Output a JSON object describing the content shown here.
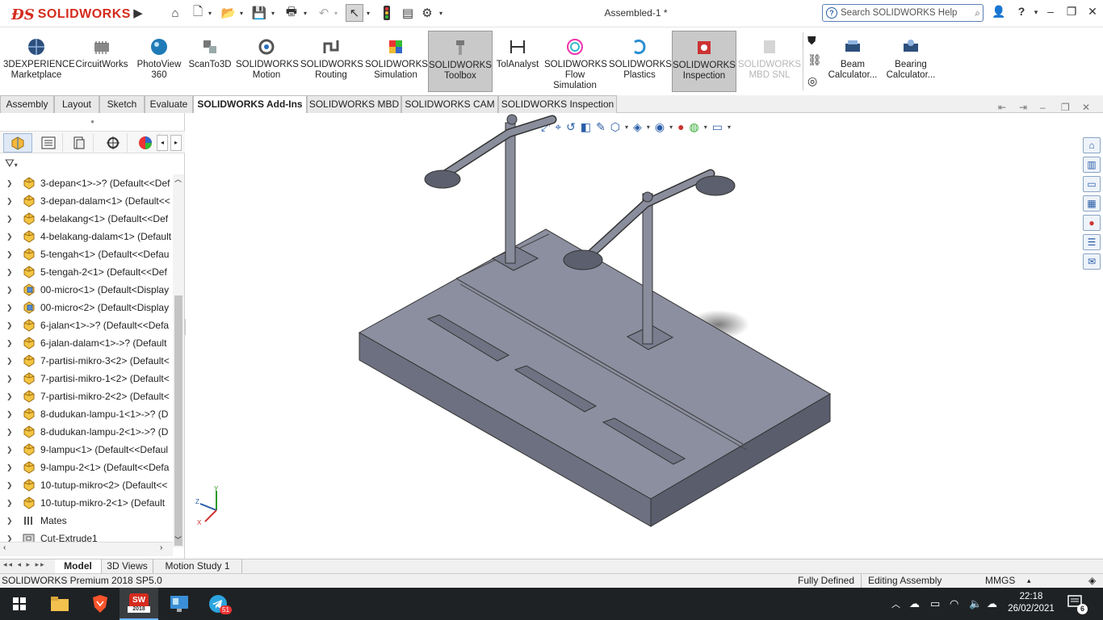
{
  "app": {
    "brand": "SOLIDWORKS",
    "document_title": "Assembled-1 *"
  },
  "search": {
    "placeholder": "Search SOLIDWORKS Help"
  },
  "commands": [
    {
      "label": "3DEXPERIENCE Marketplace",
      "icon": "globe-icon"
    },
    {
      "label": "CircuitWorks",
      "icon": "circuit-icon"
    },
    {
      "label": "PhotoView 360",
      "icon": "photoview-icon"
    },
    {
      "label": "ScanTo3D",
      "icon": "scan-icon"
    },
    {
      "label": "SOLIDWORKS Motion",
      "icon": "motion-icon"
    },
    {
      "label": "SOLIDWORKS Routing",
      "icon": "routing-icon"
    },
    {
      "label": "SOLIDWORKS Simulation",
      "icon": "simulation-icon"
    },
    {
      "label": "SOLIDWORKS Toolbox",
      "icon": "toolbox-icon",
      "state": "pressed"
    },
    {
      "label": "TolAnalyst",
      "icon": "tolanalyst-icon"
    },
    {
      "label": "SOLIDWORKS Flow Simulation",
      "icon": "flow-icon"
    },
    {
      "label": "SOLIDWORKS Plastics",
      "icon": "plastics-icon"
    },
    {
      "label": "SOLIDWORKS Inspection",
      "icon": "inspection-icon",
      "state": "pressed"
    },
    {
      "label": "SOLIDWORKS MBD SNL",
      "icon": "mbd-snl-icon",
      "state": "disabled"
    },
    {
      "label": "Beam Calculator...",
      "icon": "beam-calculator-icon"
    },
    {
      "label": "Bearing Calculator...",
      "icon": "bearing-calculator-icon"
    }
  ],
  "tabs": [
    "Assembly",
    "Layout",
    "Sketch",
    "Evaluate",
    "SOLIDWORKS Add-Ins",
    "SOLIDWORKS MBD",
    "SOLIDWORKS CAM",
    "SOLIDWORKS Inspection"
  ],
  "active_tab": "SOLIDWORKS Add-Ins",
  "tree": [
    {
      "label": "3-depan<1>->? (Default<<Def",
      "kind": "part"
    },
    {
      "label": "3-depan-dalam<1> (Default<<",
      "kind": "part"
    },
    {
      "label": "4-belakang<1> (Default<<Def",
      "kind": "part"
    },
    {
      "label": "4-belakang-dalam<1> (Default",
      "kind": "part"
    },
    {
      "label": "5-tengah<1> (Default<<Defau",
      "kind": "part"
    },
    {
      "label": "5-tengah-2<1> (Default<<Def",
      "kind": "part"
    },
    {
      "label": "00-micro<1> (Default<Display",
      "kind": "subassembly"
    },
    {
      "label": "00-micro<2> (Default<Display",
      "kind": "subassembly"
    },
    {
      "label": "6-jalan<1>->? (Default<<Defa",
      "kind": "part"
    },
    {
      "label": "6-jalan-dalam<1>->? (Default",
      "kind": "part"
    },
    {
      "label": "7-partisi-mikro-3<2> (Default<",
      "kind": "part"
    },
    {
      "label": "7-partisi-mikro-1<2> (Default<",
      "kind": "part"
    },
    {
      "label": "7-partisi-mikro-2<2> (Default<",
      "kind": "part"
    },
    {
      "label": "8-dudukan-lampu-1<1>->? (D",
      "kind": "part"
    },
    {
      "label": "8-dudukan-lampu-2<1>->? (D",
      "kind": "part"
    },
    {
      "label": "9-lampu<1> (Default<<Defaul",
      "kind": "part"
    },
    {
      "label": "9-lampu-2<1> (Default<<Defa",
      "kind": "part"
    },
    {
      "label": "10-tutup-mikro<2> (Default<<",
      "kind": "part"
    },
    {
      "label": "10-tutup-mikro-2<1> (Default",
      "kind": "part"
    },
    {
      "label": "Mates",
      "kind": "mates"
    },
    {
      "label": "Cut-Extrude1",
      "kind": "feature"
    }
  ],
  "bottom_tabs": [
    "Model",
    "3D Views",
    "Motion Study 1"
  ],
  "active_bottom_tab": "Model",
  "status": {
    "version": "SOLIDWORKS Premium 2018 SP5.0",
    "definition": "Fully Defined",
    "mode": "Editing Assembly",
    "units": "MMGS"
  },
  "taskbar": {
    "time": "22:18",
    "date": "26/02/2021",
    "notifications": "6",
    "telegram_badge": "51",
    "sw_badge": "2018"
  },
  "colors": {
    "accent": "#d52b1e",
    "model_gray": "#8a8d9c",
    "model_dark": "#5c5f6d",
    "taskbar": "#1f2224"
  }
}
